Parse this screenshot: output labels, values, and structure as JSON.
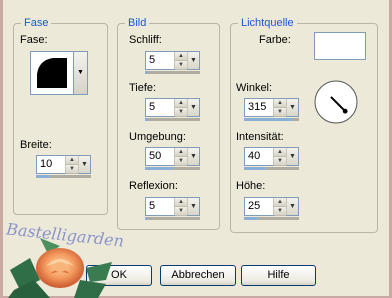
{
  "groups": {
    "fase": "Fase",
    "bild": "Bild",
    "licht": "Lichtquelle"
  },
  "fase": {
    "fase_label": "Fase:",
    "breite_label": "Breite:",
    "breite_value": "10",
    "breite_level": 0.25
  },
  "bild": {
    "schliff_label": "Schliff:",
    "schliff_value": "5",
    "schliff_level": 0.05,
    "tiefe_label": "Tiefe:",
    "tiefe_value": "5",
    "tiefe_level": 0.05,
    "umgebung_label": "Umgebung:",
    "umgebung_value": "50",
    "umgebung_level": 0.5,
    "reflexion_label": "Reflexion:",
    "reflexion_value": "5",
    "reflexion_level": 0.05
  },
  "licht": {
    "farbe_label": "Farbe:",
    "farbe_color": "#ffffff",
    "winkel_label": "Winkel:",
    "winkel_value": "315",
    "winkel_level": 0.875,
    "intensitaet_label": "Intensität:",
    "intensitaet_value": "40",
    "intensitaet_level": 0.4,
    "hoehe_label": "Höhe:",
    "hoehe_value": "25",
    "hoehe_level": 0.25
  },
  "buttons": {
    "ok": "OK",
    "abbrechen": "Abbrechen",
    "hilfe": "Hilfe"
  },
  "logo_text": "Bastelligarden",
  "colors": {
    "group_title": "#1b54d4",
    "dialog_bg": "#ece9d8"
  },
  "icons": {
    "spin_up": "triangle-up",
    "spin_down": "triangle-down",
    "dropdown": "chevron-down"
  }
}
